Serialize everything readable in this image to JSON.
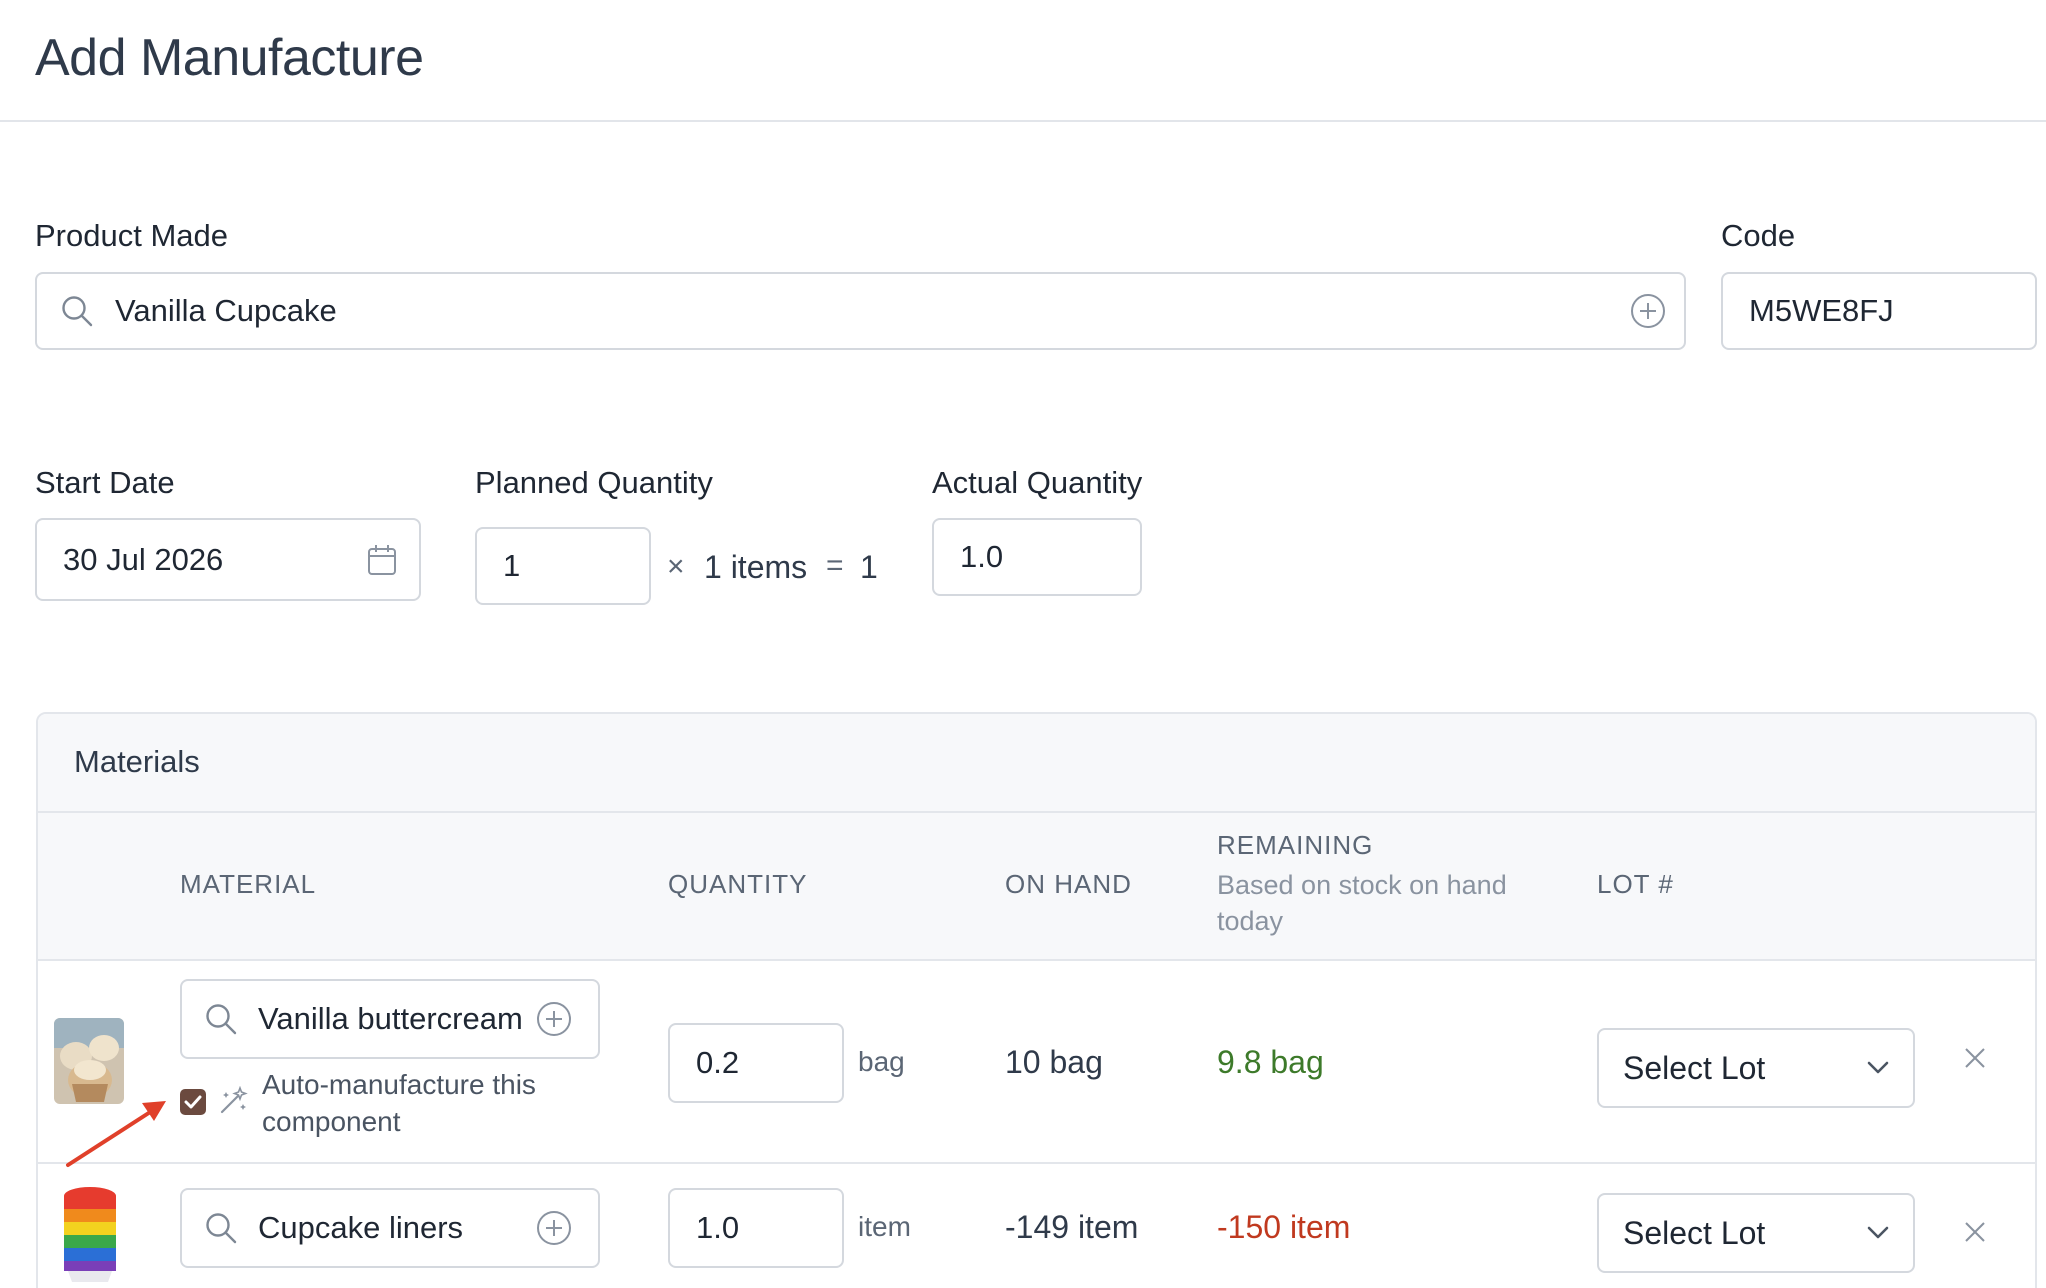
{
  "page": {
    "title": "Add Manufacture"
  },
  "product": {
    "label": "Product Made",
    "value": "Vanilla Cupcake"
  },
  "code": {
    "label": "Code",
    "value": "M5WE8FJ"
  },
  "start_date": {
    "label": "Start Date",
    "value": "30 Jul 2026"
  },
  "planned_quantity": {
    "label": "Planned Quantity",
    "value": "1",
    "times": "×",
    "items": "1 items",
    "equals": "=",
    "result": "1"
  },
  "actual_quantity": {
    "label": "Actual Quantity",
    "value": "1.0"
  },
  "materials": {
    "title": "Materials",
    "headers": {
      "material": "MATERIAL",
      "quantity": "QUANTITY",
      "on_hand": "ON HAND",
      "remaining": "REMAINING",
      "remaining_sub": "Based on stock on hand today",
      "lot": "LOT #"
    },
    "rows": [
      {
        "material": "Vanilla buttercream",
        "quantity": "0.2",
        "unit": "bag",
        "on_hand": "10 bag",
        "remaining": "9.8 bag",
        "remaining_status": "ok",
        "lot": "Select Lot",
        "auto_manufacture": "Auto-manufacture this component",
        "auto_checked": true
      },
      {
        "material": "Cupcake liners",
        "quantity": "1.0",
        "unit": "item",
        "on_hand": "-149 item",
        "remaining": "-150 item",
        "remaining_status": "negative",
        "lot": "Select Lot"
      }
    ]
  },
  "colors": {
    "remaining_ok": "#3d7a2a",
    "remaining_negative": "#c0391f",
    "checkbox": "#6b4a3f",
    "annotation_arrow": "#e0402a"
  },
  "icons": {
    "search": "search-icon",
    "add": "plus-circle-icon",
    "calendar": "calendar-icon",
    "chevron": "chevron-down-icon",
    "remove": "close-icon",
    "magic": "magic-wand-icon",
    "annotation": "arrow-annotation"
  }
}
